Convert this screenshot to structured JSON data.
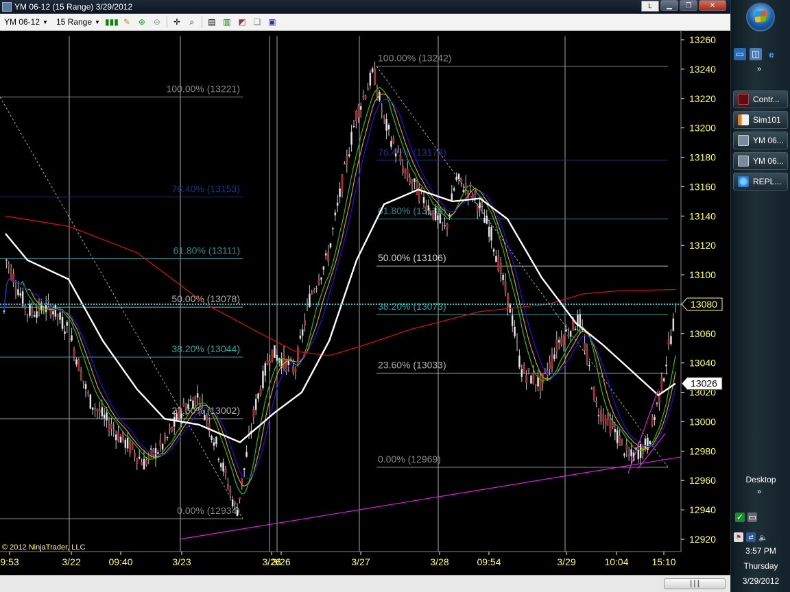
{
  "window": {
    "title": "YM 06-12 (15 Range)  3/29/2012",
    "link_button": "L",
    "minimize": "▁",
    "restore": "❐",
    "close": "✕"
  },
  "toolbar": {
    "instrument": "YM 06-12",
    "interval": "15 Range"
  },
  "chart": {
    "copyright": "© 2012 NinjaTrader, LLC",
    "price_axis_ticks": [
      "13260",
      "13240",
      "13220",
      "13200",
      "13180",
      "13160",
      "13140",
      "13120",
      "13100",
      "13080",
      "13060",
      "13040",
      "13020",
      "13000",
      "12980",
      "12960",
      "12940",
      "12920"
    ],
    "time_axis_labels": [
      "9:53",
      "3/22",
      "09:40",
      "3/23",
      "3/26",
      "3/26",
      "3/27",
      "3/28",
      "09:54",
      "3/29",
      "10:04",
      "15:10"
    ],
    "price_markers": [
      {
        "label": "13080",
        "price": 13080
      },
      {
        "label": "13026",
        "price": 13026
      }
    ],
    "fib_sets": [
      {
        "name": "left",
        "levels": [
          {
            "text": "100.00% (13221)",
            "price": 13221,
            "color": "#8a8a8a"
          },
          {
            "text": "76.40% (13153)",
            "price": 13153,
            "color": "#2a2a8a"
          },
          {
            "text": "61.80% (13111)",
            "price": 13111,
            "color": "#2a8a8a"
          },
          {
            "text": "50.00% (13078)",
            "price": 13078,
            "color": "#b0b0b0"
          },
          {
            "text": "38.20% (13044)",
            "price": 13044,
            "color": "#3aa0a0"
          },
          {
            "text": "23.60% (13002)",
            "price": 13002,
            "color": "#b0b0b0"
          },
          {
            "text": "0.00% (12934)",
            "price": 12934,
            "color": "#8a8a8a"
          }
        ]
      },
      {
        "name": "right",
        "levels": [
          {
            "text": "100.00% (13242)",
            "price": 13242,
            "color": "#8a8a8a"
          },
          {
            "text": "76.40% (13178)",
            "price": 13178,
            "color": "#2a2a8a"
          },
          {
            "text": "61.80% (13138)",
            "price": 13138,
            "color": "#2a8a8a"
          },
          {
            "text": "50.00% (13106)",
            "price": 13106,
            "color": "#d0d0d0"
          },
          {
            "text": "38.20% (13073)",
            "price": 13073,
            "color": "#3aa0a0"
          },
          {
            "text": "23.60% (13033)",
            "price": 13033,
            "color": "#b0b0b0"
          },
          {
            "text": "0.00% (12969)",
            "price": 12969,
            "color": "#8a8a8a"
          }
        ]
      }
    ],
    "colors": {
      "axis_text": "#ffff66",
      "grid": "#c8c8c8",
      "up_bar": "#e8e8e8",
      "down_bar": "#c02020",
      "sma_long": "#d01010",
      "sma_white": "#ffffff",
      "ema_green": "#20c020",
      "ema_orange": "#e0a000",
      "ema_blue": "#1a1ae0",
      "trendline": "#e020e0",
      "current_price_line": "#30c8c8"
    }
  },
  "taskbar": {
    "items": [
      {
        "label": "Contr...",
        "icon": "control-center-icon"
      },
      {
        "label": "Sim101",
        "icon": "accounts-icon"
      },
      {
        "label": "YM 06...",
        "icon": "chart-icon"
      },
      {
        "label": "YM 06...",
        "icon": "chart-icon"
      },
      {
        "label": "REPL...",
        "icon": "ie-icon"
      }
    ],
    "desktop_label": "Desktop",
    "clock_time": "3:57 PM",
    "clock_day": "Thursday",
    "clock_date": "3/29/2012"
  }
}
